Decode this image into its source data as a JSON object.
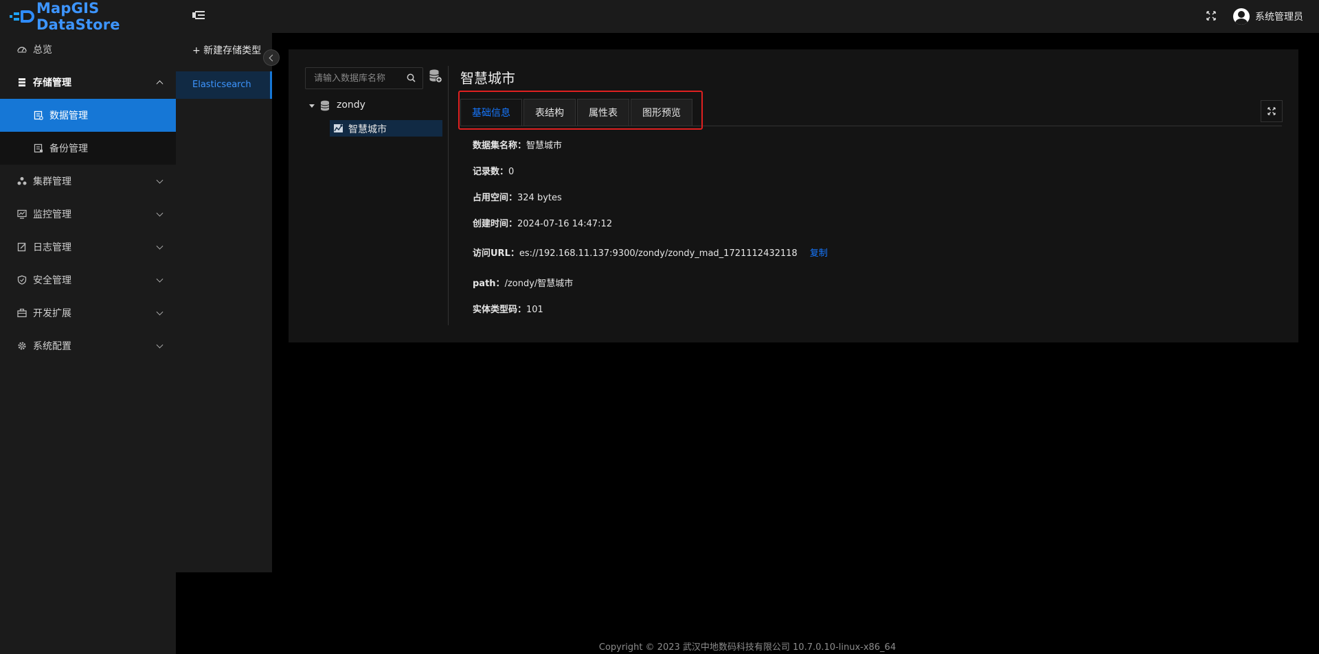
{
  "app": {
    "title": "MapGIS DataStore"
  },
  "header": {
    "user_name": "系统管理员"
  },
  "sidebar": {
    "items": [
      {
        "label": "总览"
      },
      {
        "label": "存储管理"
      },
      {
        "label": "数据管理"
      },
      {
        "label": "备份管理"
      },
      {
        "label": "集群管理"
      },
      {
        "label": "监控管理"
      },
      {
        "label": "日志管理"
      },
      {
        "label": "安全管理"
      },
      {
        "label": "开发扩展"
      },
      {
        "label": "系统配置"
      }
    ]
  },
  "type_panel": {
    "new_type_label": "+ 新建存储类型",
    "selected_type": "Elasticsearch"
  },
  "tree": {
    "search_placeholder": "请输入数据库名称",
    "root": "zondy",
    "leaf": "智慧城市"
  },
  "detail": {
    "title": "智慧城市",
    "tabs": [
      {
        "label": "基础信息"
      },
      {
        "label": "表结构"
      },
      {
        "label": "属性表"
      },
      {
        "label": "图形预览"
      }
    ],
    "fields": [
      {
        "label": "数据集名称：",
        "value": "智慧城市"
      },
      {
        "label": "记录数：",
        "value": "0"
      },
      {
        "label": "占用空间：",
        "value": "324 bytes"
      },
      {
        "label": "创建时间：",
        "value": "2024-07-16 14:47:12"
      },
      {
        "label": "访问URL：",
        "value": "es://192.168.11.137:9300/zondy/zondy_mad_1721112432118"
      },
      {
        "label": "path：",
        "value": "/zondy/智慧城市"
      },
      {
        "label": "实体类型码：",
        "value": "101"
      }
    ],
    "copy_label": "复制"
  },
  "footer": {
    "text": "Copyright © 2023 武汉中地数码科技有限公司 10.7.0.10-linux-x86_64"
  },
  "colors": {
    "accent": "#1677d6",
    "link": "#1677ff",
    "highlight": "#e02020"
  }
}
